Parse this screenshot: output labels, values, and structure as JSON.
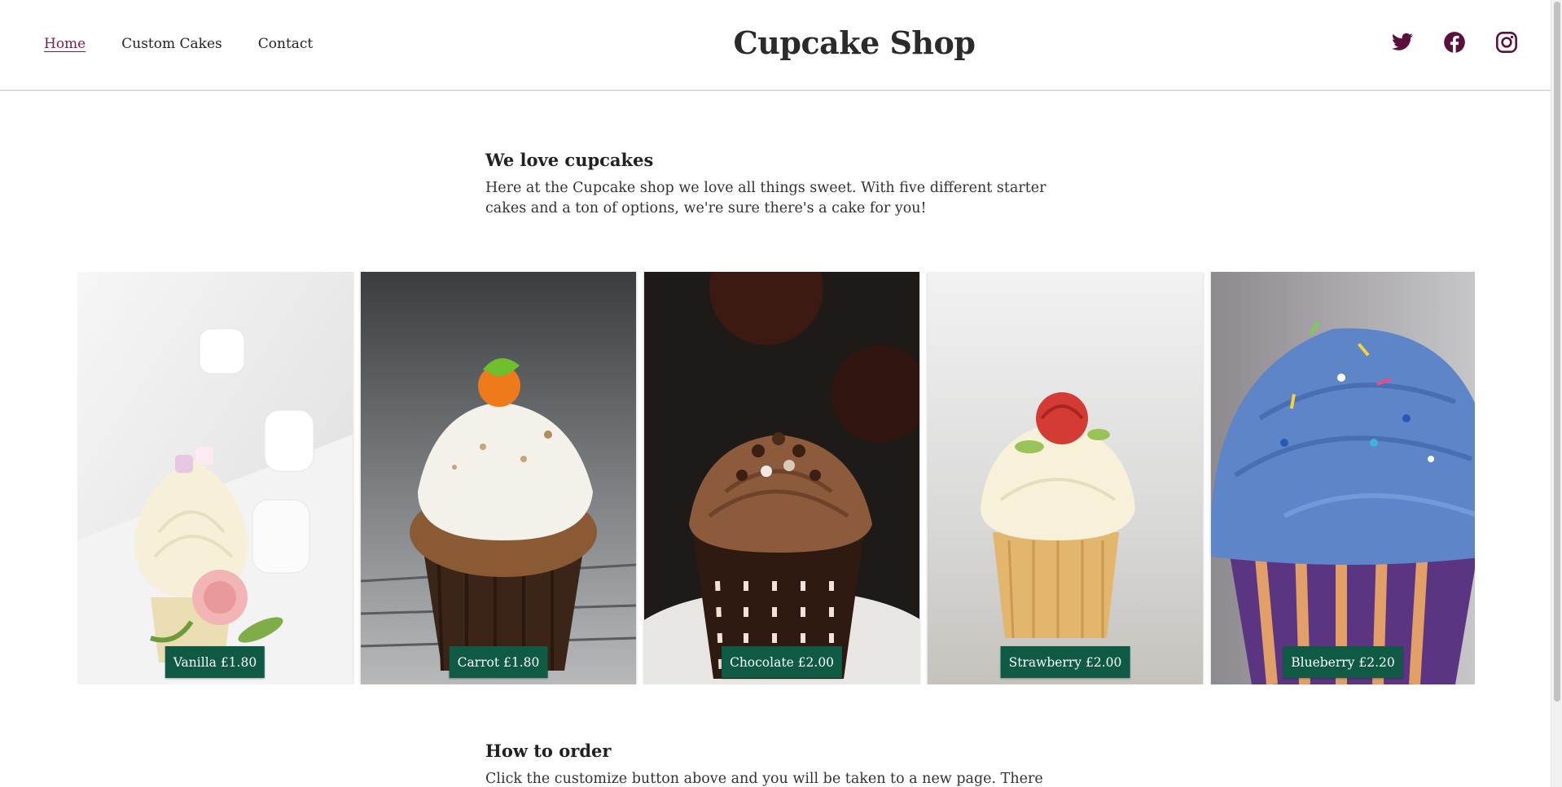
{
  "header": {
    "nav": [
      {
        "label": "Home",
        "active": true
      },
      {
        "label": "Custom Cakes",
        "active": false
      },
      {
        "label": "Contact",
        "active": false
      }
    ],
    "title": "Cupcake Shop",
    "social": [
      "twitter-icon",
      "facebook-icon",
      "instagram-icon"
    ],
    "accent_color": "#5c0f3a"
  },
  "intro": {
    "heading": "We love cupcakes",
    "text": "Here at the Cupcake shop we love all things sweet. With five different starter cakes and a ton of options, we're sure there's a cake for you!"
  },
  "cakes": [
    {
      "label": "Vanilla £1.80",
      "frosting": "#f5efd8",
      "wrapper": "#e8d9b0"
    },
    {
      "label": "Carrot £1.80",
      "frosting": "#f4f1ea",
      "wrapper": "#3a2418"
    },
    {
      "label": "Chocolate £2.00",
      "frosting": "#8a5a3c",
      "wrapper": "#3b2418"
    },
    {
      "label": "Strawberry £2.00",
      "frosting": "#f6f0d8",
      "wrapper": "#e0b56a"
    },
    {
      "label": "Blueberry £2.20",
      "frosting": "#5f86c8",
      "wrapper": "#6a3f8a"
    }
  ],
  "order": {
    "heading": "How to order",
    "text": "Click the customize button above and you will be taken to a new page. There you"
  },
  "price_tag_color": "#0e5a45"
}
